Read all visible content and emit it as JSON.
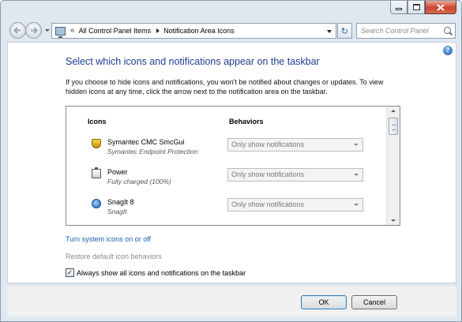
{
  "window": {
    "caption_buttons": [
      "minimize-icon",
      "maximize-icon",
      "close-icon"
    ]
  },
  "address_bar": {
    "overflow_chevron": "«",
    "breadcrumbs": [
      "All Control Panel Items",
      "Notification Area Icons"
    ],
    "refresh_glyph": "↻"
  },
  "search": {
    "placeholder": "Search Control Panel"
  },
  "help": {
    "label": "?"
  },
  "main": {
    "heading": "Select which icons and notifications appear on the taskbar",
    "description": "If you choose to hide icons and notifications, you won't be notified about changes or updates. To view hidden icons at any time, click the arrow next to the notification area on the taskbar.",
    "columns": {
      "icons": "Icons",
      "behaviors": "Behaviors"
    },
    "items": [
      {
        "name": "Symantec CMC SmcGui",
        "subtitle": "Symantec Endpoint Protection",
        "behavior": "Only show notifications",
        "icon": "shield-icon"
      },
      {
        "name": "Power",
        "subtitle": "Fully charged (100%)",
        "behavior": "Only show notifications",
        "icon": "battery-icon"
      },
      {
        "name": "SnagIt 8",
        "subtitle": "SnagIt",
        "behavior": "Only show notifications",
        "icon": "snagit-icon"
      }
    ],
    "links": {
      "system_icons": "Turn system icons on or off",
      "restore": "Restore default icon behaviors"
    },
    "always_show": {
      "label": "Always show all icons and notifications on the taskbar",
      "checked": true,
      "mark": "✓"
    }
  },
  "footer": {
    "ok": "OK",
    "cancel": "Cancel"
  }
}
